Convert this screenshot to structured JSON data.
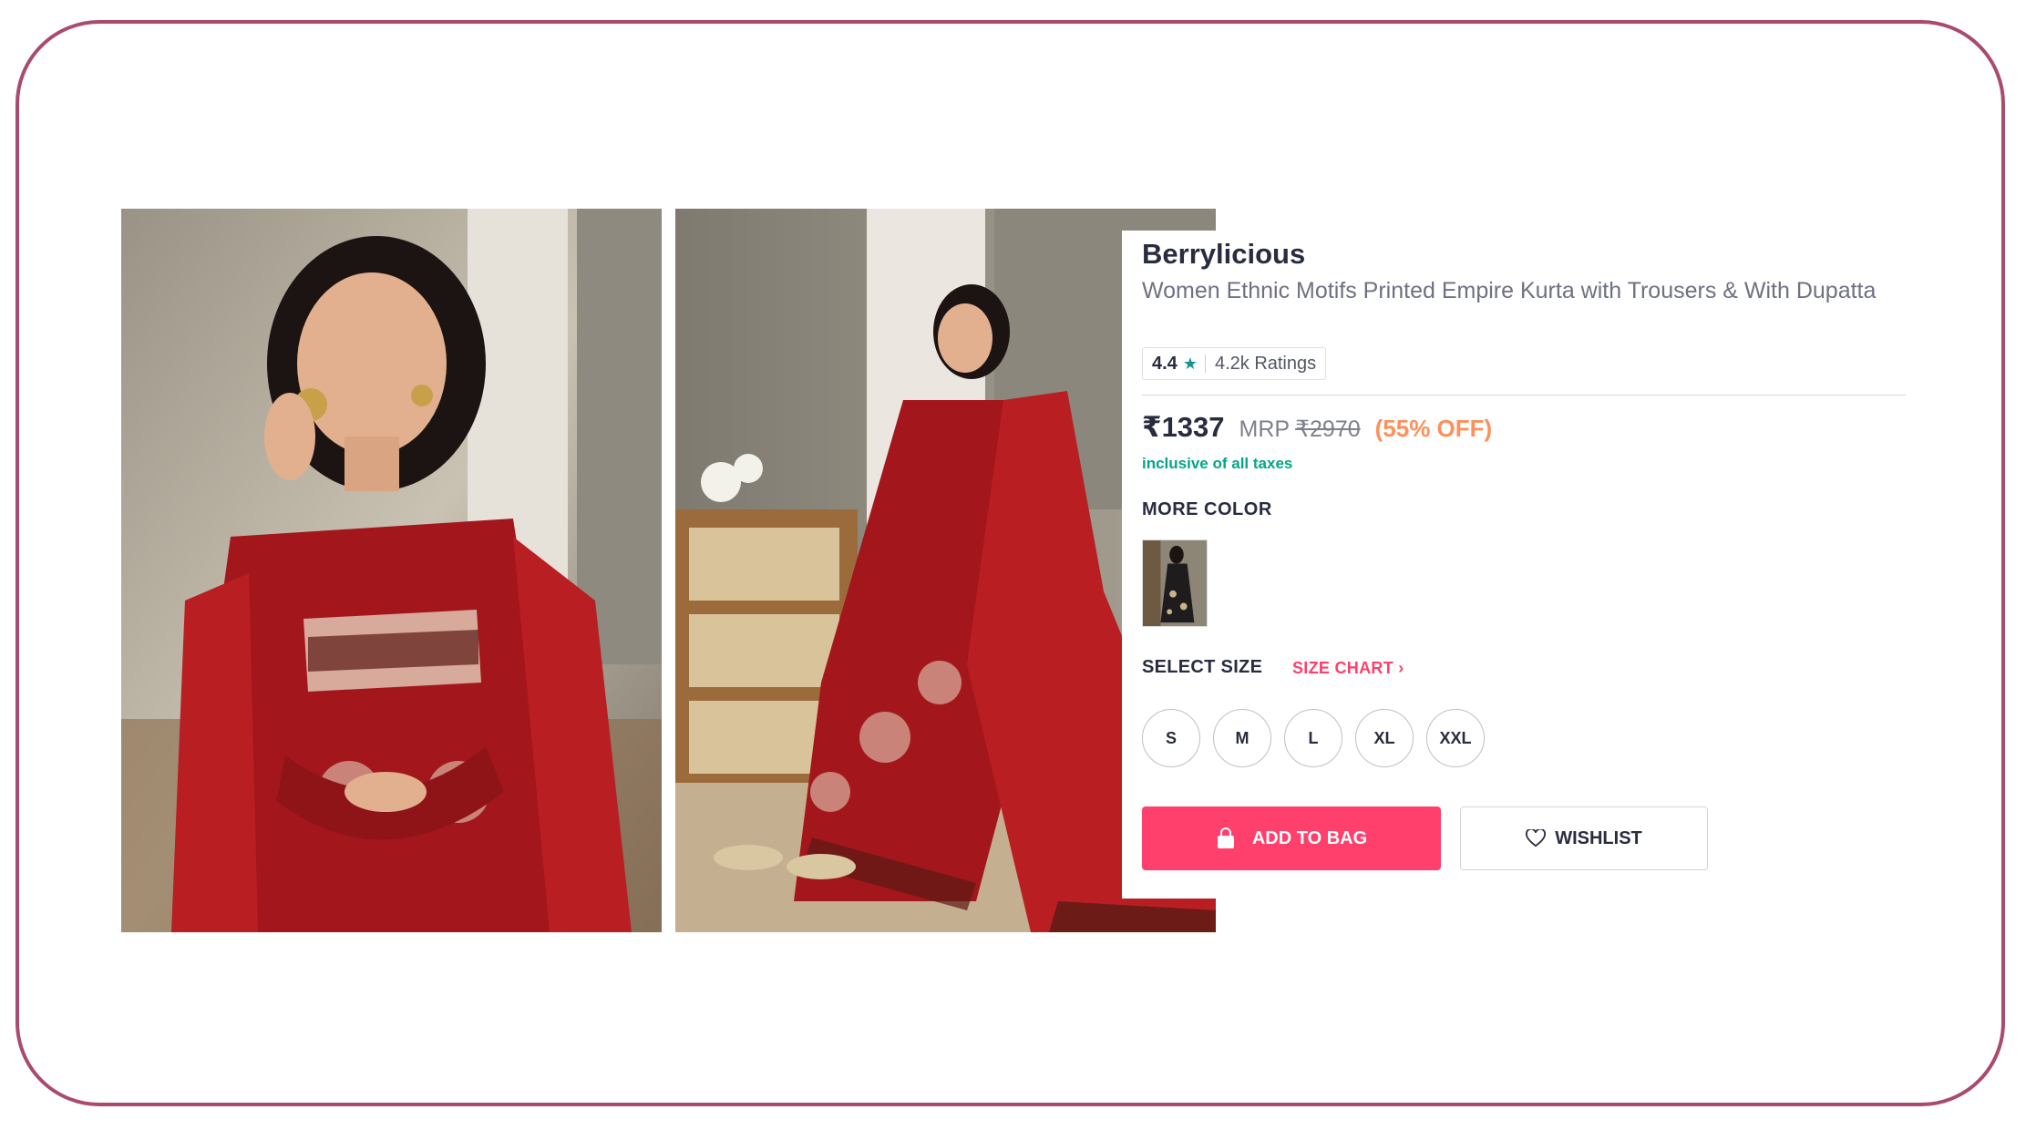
{
  "product": {
    "brand": "Berrylicious",
    "title": "Women Ethnic Motifs Printed Empire Kurta with Trousers & With Dupatta",
    "rating_value": "4.4",
    "rating_star": "★",
    "rating_count": "4.2k Ratings",
    "price": "₹1337",
    "mrp_label": "MRP",
    "mrp": "₹2970",
    "discount": "(55% OFF)",
    "taxes_note": "inclusive of all taxes"
  },
  "more_color": {
    "label": "MORE COLOR"
  },
  "size_selector": {
    "label": "SELECT SIZE",
    "size_chart_label": "SIZE CHART ›",
    "sizes": [
      "S",
      "M",
      "L",
      "XL",
      "XXL"
    ]
  },
  "actions": {
    "add_to_bag": "ADD TO BAG",
    "wishlist": "WISHLIST"
  },
  "colors": {
    "frame_border": "#a94a6e",
    "accent_pink": "#ff3f6c",
    "discount_orange": "#ff905a",
    "tax_green": "#03a685",
    "star_teal": "#14958f",
    "garment_red": "#a3171c"
  }
}
